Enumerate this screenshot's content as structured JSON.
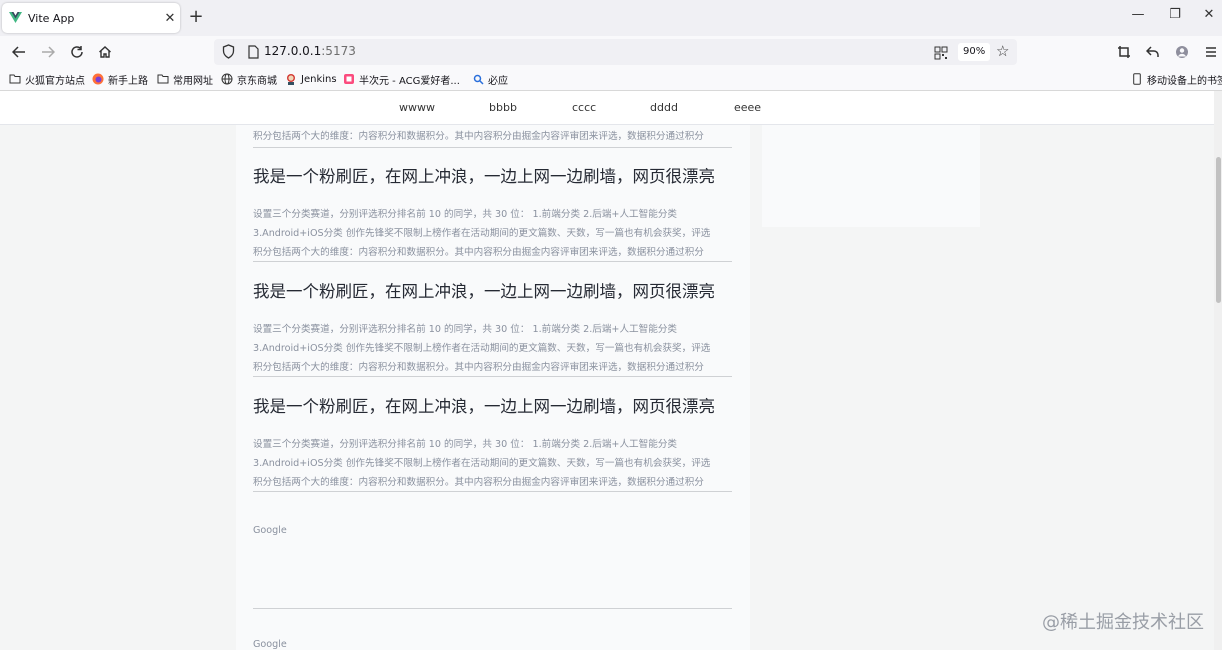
{
  "browser": {
    "tab": {
      "title": "Vite App",
      "close": "✕"
    },
    "new_tab": "+",
    "window": {
      "minimize": "—",
      "restore": "❐",
      "close": "✕"
    },
    "url": {
      "host": "127.0.0.1",
      "port": ":5173"
    },
    "zoom": "90%",
    "bookmarks": [
      "火狐官方站点",
      "新手上路",
      "常用网址",
      "京东商城",
      "Jenkins",
      "半次元 - ACG爱好者...",
      "必应"
    ],
    "mobile_bookmarks": "移动设备上的书签"
  },
  "site_nav": {
    "links": [
      "wwww",
      "bbbb",
      "cccc",
      "dddd",
      "eeee"
    ]
  },
  "articles": {
    "top_partial_line": "积分包括两个大的维度：内容积分和数据积分。其中内容积分由掘金内容评审团来评选，数据积分通过积分",
    "items": [
      {
        "title": "我是一个粉刷匠，在网上冲浪，一边上网一边刷墙，网页很漂亮",
        "line1": "设置三个分类赛道，分别评选积分排名前 10 的同学，共 30 位： 1.前端分类 2.后端+人工智能分类",
        "line2": "3.Android+iOS分类 创作先锋奖不限制上榜作者在活动期间的更文篇数、天数，写一篇也有机会获奖，评选",
        "line3": "积分包括两个大的维度：内容积分和数据积分。其中内容积分由掘金内容评审团来评选，数据积分通过积分"
      },
      {
        "title": "我是一个粉刷匠，在网上冲浪，一边上网一边刷墙，网页很漂亮",
        "line1": "设置三个分类赛道，分别评选积分排名前 10 的同学，共 30 位： 1.前端分类 2.后端+人工智能分类",
        "line2": "3.Android+iOS分类 创作先锋奖不限制上榜作者在活动期间的更文篇数、天数，写一篇也有机会获奖，评选",
        "line3": "积分包括两个大的维度：内容积分和数据积分。其中内容积分由掘金内容评审团来评选，数据积分通过积分"
      },
      {
        "title": "我是一个粉刷匠，在网上冲浪，一边上网一边刷墙，网页很漂亮",
        "line1": "设置三个分类赛道，分别评选积分排名前 10 的同学，共 30 位： 1.前端分类 2.后端+人工智能分类",
        "line2": "3.Android+iOS分类 创作先锋奖不限制上榜作者在活动期间的更文篇数、天数，写一篇也有机会获奖，评选",
        "line3": "积分包括两个大的维度：内容积分和数据积分。其中内容积分由掘金内容评审团来评选，数据积分通过积分"
      }
    ]
  },
  "ads": [
    "Google",
    "Google"
  ],
  "watermark": "@稀土掘金技术社区"
}
